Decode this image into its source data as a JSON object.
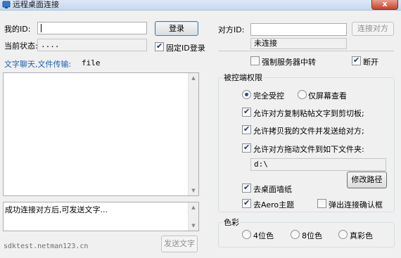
{
  "window": {
    "title": "远程桌面连接",
    "close_label": "x"
  },
  "left": {
    "my_id_label": "我的ID:",
    "my_id_value": "",
    "status_label": "当前状态:",
    "status_value": "....",
    "login_button": "登录",
    "fixed_id_label": "固定ID登录",
    "fixed_id_checked": true,
    "chat_label": "文字聊天,文件传输:",
    "chat_mode": "file",
    "chat_log": "",
    "message_input": "成功连接对方后,可发送文字...",
    "send_button": "发送文字",
    "footer": "sdktest.netman123.cn"
  },
  "right": {
    "peer_id_label": "对方ID:",
    "peer_id_value": "",
    "connect_button": "连接对方",
    "connection_status": "未连接",
    "force_relay_label": "强制服务器中转",
    "force_relay_checked": false,
    "disconnect_label": "断开",
    "disconnect_checked": true,
    "permissions": {
      "title": "被控端权限",
      "full_control_label": "完全受控",
      "full_control_selected": true,
      "view_only_label": "仅屏幕查看",
      "view_only_selected": false,
      "allow_clipboard_label": "允许对方复制粘帖文字到剪切板;",
      "allow_clipboard_checked": true,
      "allow_copy_files_label": "允许拷贝我的文件并发送给对方;",
      "allow_copy_files_checked": true,
      "allow_drag_files_label": "允许对方拖动文件到如下文件夹:",
      "allow_drag_files_checked": true,
      "folder_path": "d:\\",
      "change_path_button": "修改路径",
      "remove_wallpaper_label": "去桌面墙纸",
      "remove_wallpaper_checked": true,
      "remove_aero_label": "去Aero主题",
      "remove_aero_checked": true,
      "confirm_popup_label": "弹出连接确认框",
      "confirm_popup_checked": false
    },
    "color": {
      "title": "色彩",
      "options": [
        "4位色",
        "8位色",
        "真彩色"
      ],
      "selected_index": -1
    }
  }
}
